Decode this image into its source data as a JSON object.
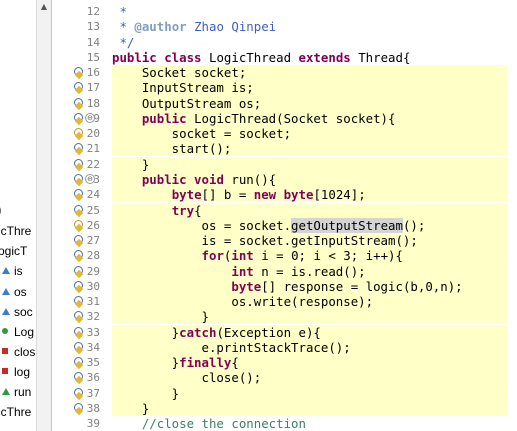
{
  "outline": {
    "items": [
      {
        "label": "",
        "icon": "collapse-arrow-icon"
      },
      {
        "label": "icThre",
        "icon": ""
      },
      {
        "label": "ogicT",
        "icon": ""
      },
      {
        "label": "is",
        "icon": "field-triangle-icon"
      },
      {
        "label": "os",
        "icon": "field-triangle-icon"
      },
      {
        "label": "soc",
        "icon": "field-triangle-icon"
      },
      {
        "label": "Log",
        "icon": "constructor-circle-icon"
      },
      {
        "label": "clos",
        "icon": "method-square-icon"
      },
      {
        "label": "log",
        "icon": "method-square-icon"
      },
      {
        "label": "run",
        "icon": "method-triangle-icon"
      },
      {
        "label": "icThre",
        "icon": ""
      }
    ]
  },
  "editor": {
    "lines": [
      {
        "n": "12",
        "hl": false,
        "m": "",
        "f": "",
        "seg": [
          {
            "t": " *",
            "c": "jd"
          }
        ]
      },
      {
        "n": "13",
        "hl": false,
        "m": "",
        "f": "",
        "seg": [
          {
            "t": " * ",
            "c": "jd"
          },
          {
            "t": "@author",
            "c": "jdtag"
          },
          {
            "t": " Zhao Qinpei",
            "c": "jd"
          }
        ]
      },
      {
        "n": "14",
        "hl": false,
        "m": "",
        "f": "",
        "seg": [
          {
            "t": " */",
            "c": "jd"
          }
        ]
      },
      {
        "n": "15",
        "hl": false,
        "m": "",
        "f": "",
        "seg": [
          {
            "t": "public class ",
            "c": "kw"
          },
          {
            "t": "LogicThread ",
            "c": ""
          },
          {
            "t": "extends ",
            "c": "kw"
          },
          {
            "t": "Thread{",
            "c": ""
          }
        ]
      },
      {
        "n": "16",
        "hl": true,
        "m": "info",
        "f": "",
        "seg": [
          {
            "t": "    Socket socket;",
            "c": ""
          }
        ]
      },
      {
        "n": "17",
        "hl": true,
        "m": "info",
        "f": "",
        "seg": [
          {
            "t": "    InputStream is;",
            "c": ""
          }
        ]
      },
      {
        "n": "18",
        "hl": true,
        "m": "info",
        "f": "",
        "seg": [
          {
            "t": "    OutputStream os;",
            "c": ""
          }
        ]
      },
      {
        "n": "19",
        "hl": true,
        "m": "info",
        "f": "⊖",
        "seg": [
          {
            "t": "    ",
            "c": ""
          },
          {
            "t": "public ",
            "c": "kw"
          },
          {
            "t": "LogicThread(Socket socket){",
            "c": ""
          }
        ]
      },
      {
        "n": "20",
        "hl": true,
        "m": "warn",
        "f": "",
        "seg": [
          {
            "t": "        socket = socket;",
            "c": ""
          }
        ]
      },
      {
        "n": "21",
        "hl": true,
        "m": "info",
        "f": "",
        "seg": [
          {
            "t": "        start();",
            "c": ""
          }
        ]
      },
      {
        "n": "22",
        "hl": true,
        "m": "info",
        "f": "",
        "seg": [
          {
            "t": "    }",
            "c": ""
          }
        ]
      },
      {
        "n": "23",
        "hl": true,
        "m": "info",
        "f": "⊖",
        "seg": [
          {
            "t": "    ",
            "c": ""
          },
          {
            "t": "public void ",
            "c": "kw"
          },
          {
            "t": "run(){",
            "c": ""
          }
        ]
      },
      {
        "n": "24",
        "hl": true,
        "m": "info",
        "f": "",
        "seg": [
          {
            "t": "        ",
            "c": ""
          },
          {
            "t": "byte",
            "c": "kw"
          },
          {
            "t": "[] b = ",
            "c": ""
          },
          {
            "t": "new byte",
            "c": "kw"
          },
          {
            "t": "[1024];",
            "c": ""
          }
        ]
      },
      {
        "n": "25",
        "hl": true,
        "m": "info",
        "f": "",
        "seg": [
          {
            "t": "        ",
            "c": ""
          },
          {
            "t": "try",
            "c": "kw"
          },
          {
            "t": "{",
            "c": ""
          }
        ]
      },
      {
        "n": "26",
        "hl": true,
        "m": "warn",
        "f": "",
        "seg": [
          {
            "t": "            os = socket.",
            "c": ""
          },
          {
            "t": "getOutputStream",
            "c": "sel"
          },
          {
            "t": "();",
            "c": ""
          }
        ]
      },
      {
        "n": "27",
        "hl": true,
        "m": "info",
        "f": "",
        "seg": [
          {
            "t": "            is = socket.getInputStream();",
            "c": ""
          }
        ]
      },
      {
        "n": "28",
        "hl": true,
        "m": "info",
        "f": "",
        "seg": [
          {
            "t": "            ",
            "c": ""
          },
          {
            "t": "for",
            "c": "kw"
          },
          {
            "t": "(",
            "c": ""
          },
          {
            "t": "int ",
            "c": "kw"
          },
          {
            "t": "i = 0; i < 3; i++){",
            "c": ""
          }
        ]
      },
      {
        "n": "29",
        "hl": true,
        "m": "info",
        "f": "",
        "seg": [
          {
            "t": "                ",
            "c": ""
          },
          {
            "t": "int ",
            "c": "kw"
          },
          {
            "t": "n = is.read();",
            "c": ""
          }
        ]
      },
      {
        "n": "30",
        "hl": true,
        "m": "info",
        "f": "",
        "seg": [
          {
            "t": "                ",
            "c": ""
          },
          {
            "t": "byte",
            "c": "kw"
          },
          {
            "t": "[] response = logic(b,0,n);",
            "c": ""
          }
        ]
      },
      {
        "n": "31",
        "hl": true,
        "m": "info",
        "f": "",
        "seg": [
          {
            "t": "                os.write(response);",
            "c": ""
          }
        ]
      },
      {
        "n": "32",
        "hl": true,
        "m": "info",
        "f": "",
        "seg": [
          {
            "t": "            }",
            "c": ""
          }
        ]
      },
      {
        "n": "33",
        "hl": true,
        "m": "info",
        "f": "",
        "seg": [
          {
            "t": "        }",
            "c": ""
          },
          {
            "t": "catch",
            "c": "kw"
          },
          {
            "t": "(Exception e){",
            "c": ""
          }
        ]
      },
      {
        "n": "34",
        "hl": true,
        "m": "info",
        "f": "",
        "seg": [
          {
            "t": "            e.printStackTrace();",
            "c": ""
          }
        ]
      },
      {
        "n": "35",
        "hl": true,
        "m": "info",
        "f": "",
        "seg": [
          {
            "t": "        }",
            "c": ""
          },
          {
            "t": "finally",
            "c": "kw"
          },
          {
            "t": "{",
            "c": ""
          }
        ]
      },
      {
        "n": "36",
        "hl": true,
        "m": "info",
        "f": "",
        "seg": [
          {
            "t": "            close();",
            "c": ""
          }
        ]
      },
      {
        "n": "37",
        "hl": true,
        "m": "info",
        "f": "",
        "seg": [
          {
            "t": "        }",
            "c": ""
          }
        ]
      },
      {
        "n": "38",
        "hl": true,
        "m": "info",
        "f": "",
        "seg": [
          {
            "t": "    }",
            "c": ""
          }
        ]
      },
      {
        "n": "39",
        "hl": false,
        "m": "",
        "f": "",
        "seg": [
          {
            "t": "    //close the connection",
            "c": "cm"
          }
        ]
      }
    ]
  }
}
